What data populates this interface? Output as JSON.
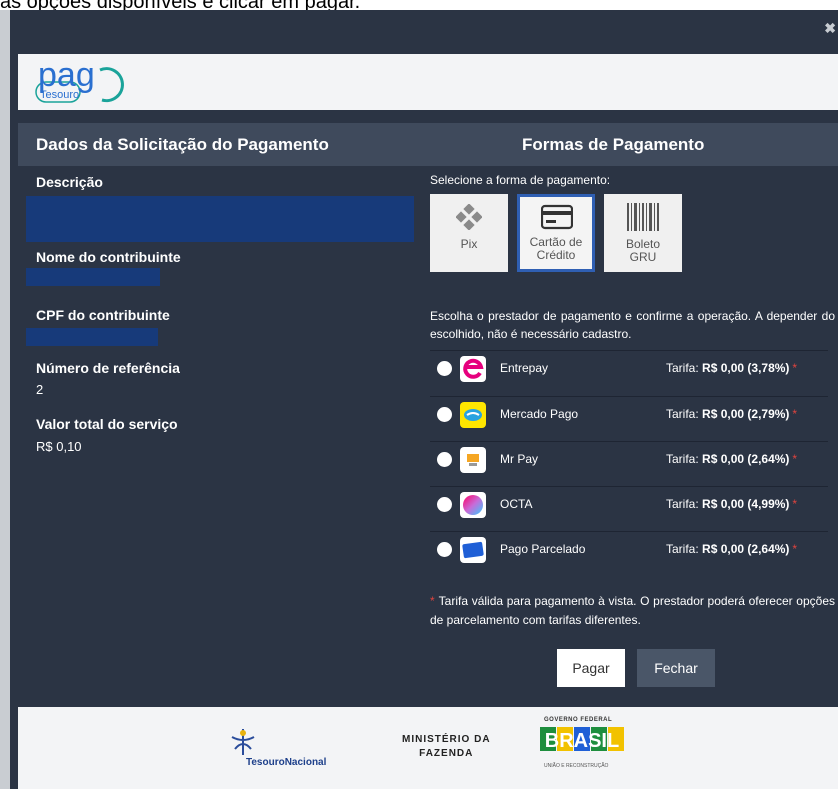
{
  "caption": "as opções disponíveis e clicar em pagar.",
  "modal": {
    "close_glyph": "✖"
  },
  "logo": {
    "pag": "pag",
    "tesouro": "Tesouro"
  },
  "header": {
    "left_title": "Dados da Solicitação do Pagamento",
    "right_title": "Formas de Pagamento"
  },
  "details": {
    "descricao_label": "Descrição",
    "nome_label": "Nome do contribuinte",
    "cpf_label": "CPF do contribuinte",
    "referencia_label": "Número de referência",
    "referencia_value": "2",
    "valor_label": "Valor total do serviço",
    "valor_value": "R$ 0,10"
  },
  "payment": {
    "select_label": "Selecione a forma de pagamento:",
    "methods": [
      {
        "label1": "Pix",
        "label2": "",
        "icon": "pix-icon",
        "selected": false
      },
      {
        "label1": "Cartão de",
        "label2": "Crédito",
        "icon": "credit-card-icon",
        "selected": true
      },
      {
        "label1": "Boleto",
        "label2": "GRU",
        "icon": "barcode-icon",
        "selected": false
      }
    ],
    "info": "Escolha o prestador de pagamento e confirme a operação. A depender do escolhido, não é necessário cadastro.",
    "providers": [
      {
        "name": "Entrepay",
        "tarifa_label": "Tarifa:",
        "valor": "R$ 0,00 (3,78%)",
        "icon": "entrepay-logo-icon",
        "color": "#e6007e"
      },
      {
        "name": "Mercado Pago",
        "tarifa_label": "Tarifa:",
        "valor": "R$ 0,00 (2,79%)",
        "icon": "mercado-pago-logo-icon",
        "color": "#ffe600"
      },
      {
        "name": "Mr Pay",
        "tarifa_label": "Tarifa:",
        "valor": "R$ 0,00 (2,64%)",
        "icon": "mr-pay-logo-icon",
        "color": "#f5a623"
      },
      {
        "name": "OCTA",
        "tarifa_label": "Tarifa:",
        "valor": "R$ 0,00 (4,99%)",
        "icon": "octa-logo-icon",
        "color": "#c86bd8"
      },
      {
        "name": "Pago Parcelado",
        "tarifa_label": "Tarifa:",
        "valor": "R$ 0,00 (2,64%)",
        "icon": "pago-parcelado-logo-icon",
        "color": "#1f5fd6"
      }
    ],
    "asterisk": "*",
    "footnote": "Tarifa válida para pagamento à vista. O prestador poderá oferecer opções de parcelamento com tarifas diferentes."
  },
  "buttons": {
    "pagar": "Pagar",
    "fechar": "Fechar"
  },
  "footer": {
    "tesouro_nacional": "TesouroNacional",
    "ministerio_line1": "MINISTÉRIO DA",
    "ministerio_line2": "FAZENDA",
    "governo_federal": "GOVERNO FEDERAL",
    "brasil": "BRASIL",
    "uniao": "UNIÃO E RECONSTRUÇÃO"
  }
}
